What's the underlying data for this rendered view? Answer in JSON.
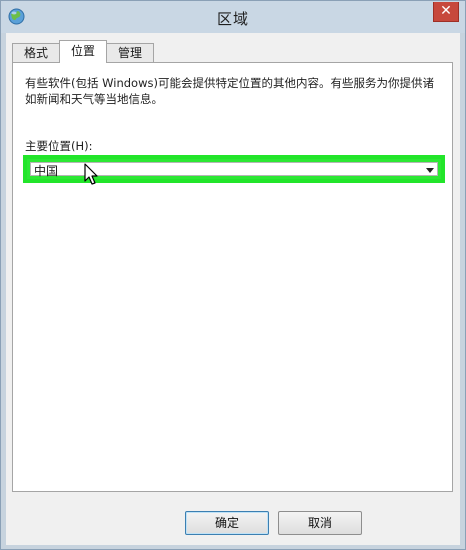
{
  "window": {
    "title": "区域",
    "close_glyph": "✕",
    "app_icon": "globe-icon"
  },
  "tabs": [
    {
      "label": "格式",
      "active": false
    },
    {
      "label": "位置",
      "active": true
    },
    {
      "label": "管理",
      "active": false
    }
  ],
  "location_tab": {
    "description": "有些软件(包括 Windows)可能会提供特定位置的其他内容。有些服务为你提供诸如新闻和天气等当地信息。",
    "primary_location_label": "主要位置(H):",
    "primary_location_value": "中国",
    "highlight_color": "#22e52a"
  },
  "buttons": {
    "ok_label": "确定",
    "cancel_label": "取消"
  }
}
